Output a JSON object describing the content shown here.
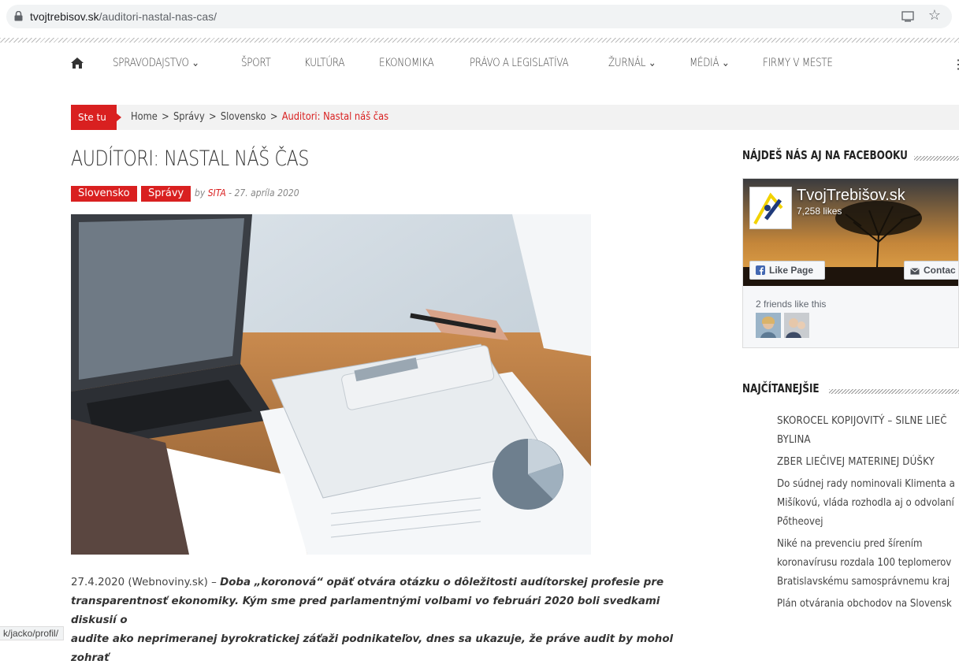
{
  "browser": {
    "url_host": "tvojtrebisov.sk",
    "url_path": "/auditori-nastal-nas-cas/"
  },
  "nav": {
    "items": [
      {
        "label": "SPRAVODAJSTVO ⌄"
      },
      {
        "label": "ŠPORT"
      },
      {
        "label": "KULTÚRA"
      },
      {
        "label": "EKONOMIKA"
      },
      {
        "label": "PRÁVO A LEGISLATÍVA"
      },
      {
        "label": "ŽURNÁL ⌄"
      },
      {
        "label": "MÉDIÁ ⌄"
      },
      {
        "label": "FIRMY V MESTE"
      }
    ]
  },
  "breadcrumb": {
    "badge": "Ste tu",
    "items": [
      "Home",
      "Správy",
      "Slovensko"
    ],
    "separator": ">",
    "current": "Auditori: Nastal náš čas"
  },
  "article": {
    "title": "AUDÍTORI: NASTAL NÁŠ ČAS",
    "tags": [
      "Slovensko",
      "Správy"
    ],
    "by": "by",
    "author": "SITA",
    "date": "- 27. apríla 2020",
    "lead_prefix": "27.4.2020 (Webnoviny.sk) – ",
    "lead_bold_line1": "Doba „koronová“ opäť otvára otázku o dôležitosti audítorskej profesie pre",
    "lead_bold_line2": "transparentnosť ekonomiky. Kým sme pred parlamentnými volbami vo februári 2020 boli svedkami diskusií o",
    "lead_bold_line3": "audite ako neprimeranej byrokratickej záťaži podnikateľov, dnes sa ukazuje, že práve audit by mohol zohrať"
  },
  "status_bar": {
    "link": "k/jacko/profil/"
  },
  "sidebar": {
    "facebook_title": "NÁJDEŠ NÁS AJ NA FACEBOOKU",
    "fb": {
      "page_name": "TvojTrebišov.sk",
      "likes": "7,258 likes",
      "like_button": "Like Page",
      "contact_button": "Contac",
      "friends": "2 friends like this"
    },
    "popular_title": "NAJČÍTANEJŠIE",
    "popular": [
      {
        "lines": [
          "SKOROCEL KOPIJOVITÝ – SILNE LIEČ",
          "BYLINA"
        ]
      },
      {
        "lines": [
          "ZBER LIEČIVEJ MATERINEJ DÚŠKY"
        ]
      },
      {
        "lines": [
          "Do súdnej rady nominovali Klimenta a",
          "Mišíkovú, vláda rozhodla aj o odvolaní",
          "Pőtheovej"
        ]
      },
      {
        "lines": [
          "Niké na prevenciu pred šírením",
          "koronavírusu rozdala 100 teplomerov",
          "Bratislavskému samosprávnemu kraj"
        ]
      },
      {
        "lines": [
          "Plán otvárania obchodov na Slovensk"
        ]
      }
    ]
  },
  "colors": {
    "accent": "#d92020",
    "fb_blue": "#3b5998"
  }
}
